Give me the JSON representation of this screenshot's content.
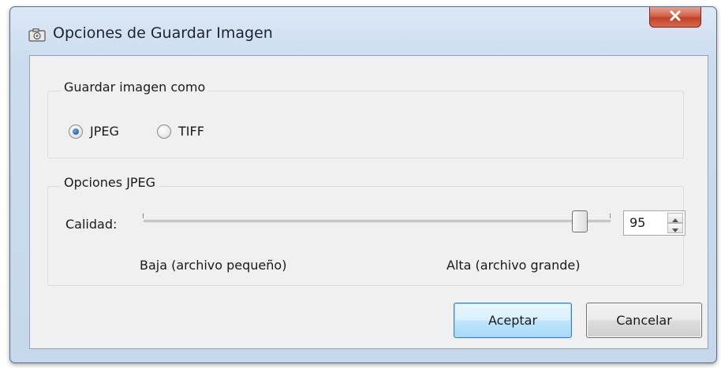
{
  "window": {
    "title": "Opciones de Guardar Imagen",
    "icon": "camera-icon",
    "close_icon": "close-icon"
  },
  "save_as_group": {
    "title": "Guardar imagen como",
    "options": [
      {
        "label": "JPEG",
        "selected": true
      },
      {
        "label": "TIFF",
        "selected": false
      }
    ]
  },
  "jpeg_group": {
    "title": "Opciones JPEG",
    "quality_label": "Calidad:",
    "quality_value": "95",
    "quality_level_percent": 95,
    "low_label": "Baja (archivo pequeño)",
    "high_label": "Alta (archivo grande)"
  },
  "buttons": {
    "ok_label": "Aceptar",
    "cancel_label": "Cancelar"
  },
  "colors": {
    "close_button": "#c24129",
    "radio_selected": "#1f5fa8",
    "default_button_border": "#3c7fb1"
  }
}
